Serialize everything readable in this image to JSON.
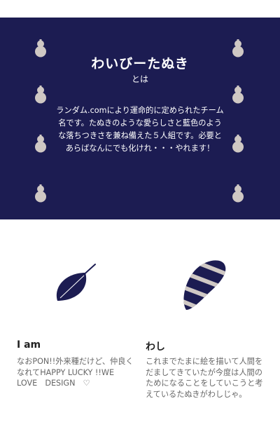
{
  "hero": {
    "title": "わいびーたぬき",
    "subtitle": "とは",
    "description": "ランダム.comにより運命的に定められたチーム名です。たぬきのような愛らしさと藍色のような落ちつきさを兼ね備えた５人組です。必要とあらばなんにでも化けれ・・・やれます！",
    "background_color": "#1c1c52",
    "decoration_icon": "gourd-icon",
    "decoration_color": "#cfc8c4"
  },
  "cards": [
    {
      "icon": "leaf-icon",
      "title": "I am",
      "text": "なおPON!!外来種だけど、仲良くなれてHAPPY LUCKY !!WE　LOVE　DESIGN　♡"
    },
    {
      "icon": "striped-tail-icon",
      "title": "わし",
      "text": "これまでたまに絵を描いて人間をだましてきていたが今度は人間のためになることをしていこうと考えているたぬきがわしじゃ。"
    }
  ],
  "colors": {
    "navy": "#1c1c52",
    "gourd": "#cfc8c4",
    "text_gray": "#666666"
  }
}
